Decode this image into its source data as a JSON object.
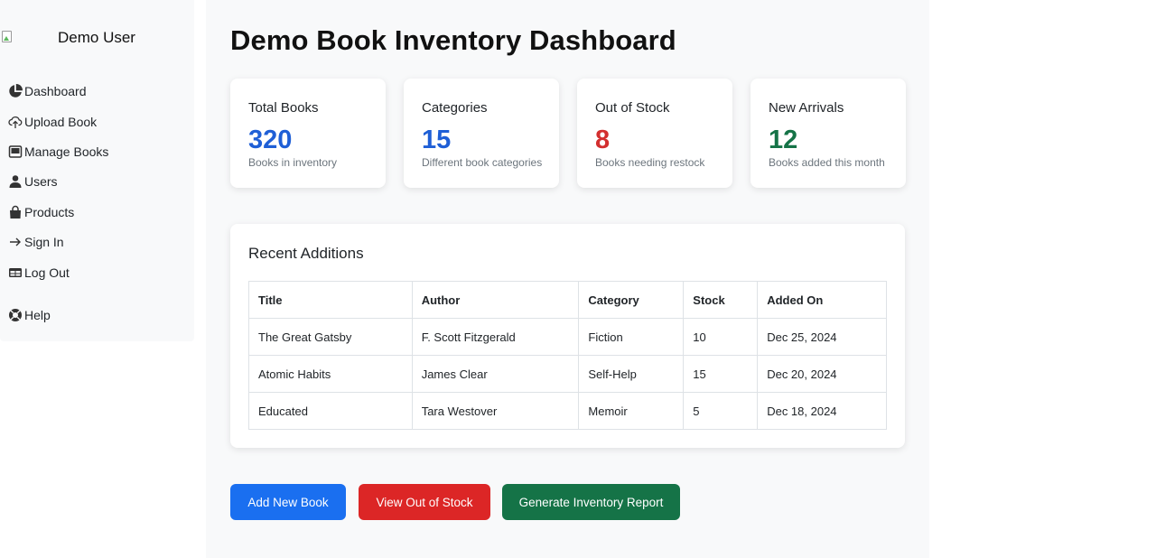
{
  "sidebar": {
    "user_name": "Demo User",
    "items": [
      {
        "label": "Dashboard",
        "icon": "pie-chart-icon"
      },
      {
        "label": "Upload Book",
        "icon": "cloud-upload-icon"
      },
      {
        "label": "Manage Books",
        "icon": "inbox-icon"
      },
      {
        "label": "Users",
        "icon": "user-icon"
      },
      {
        "label": "Products",
        "icon": "shopping-bag-icon"
      },
      {
        "label": "Sign In",
        "icon": "arrow-right-icon"
      },
      {
        "label": "Log Out",
        "icon": "table-icon"
      },
      {
        "label": "Help",
        "icon": "lifebuoy-icon"
      }
    ]
  },
  "main": {
    "title": "Demo Book Inventory Dashboard",
    "cards": [
      {
        "title": "Total Books",
        "value": "320",
        "subtitle": "Books in inventory",
        "color": "#1f5fd6"
      },
      {
        "title": "Categories",
        "value": "15",
        "subtitle": "Different book categories",
        "color": "#1f5fd6"
      },
      {
        "title": "Out of Stock",
        "value": "8",
        "subtitle": "Books needing restock",
        "color": "#d32f2f"
      },
      {
        "title": "New Arrivals",
        "value": "12",
        "subtitle": "Books added this month",
        "color": "#157347"
      }
    ],
    "recent": {
      "title": "Recent Additions",
      "columns": [
        "Title",
        "Author",
        "Category",
        "Stock",
        "Added On"
      ],
      "rows": [
        [
          "The Great Gatsby",
          "F. Scott Fitzgerald",
          "Fiction",
          "10",
          "Dec 25, 2024"
        ],
        [
          "Atomic Habits",
          "James Clear",
          "Self-Help",
          "15",
          "Dec 20, 2024"
        ],
        [
          "Educated",
          "Tara Westover",
          "Memoir",
          "5",
          "Dec 18, 2024"
        ]
      ]
    },
    "actions": [
      {
        "label": "Add New Book",
        "color": "#1a6ff0"
      },
      {
        "label": "View Out of Stock",
        "color": "#dc2626"
      },
      {
        "label": "Generate Inventory Report",
        "color": "#157347"
      }
    ]
  }
}
